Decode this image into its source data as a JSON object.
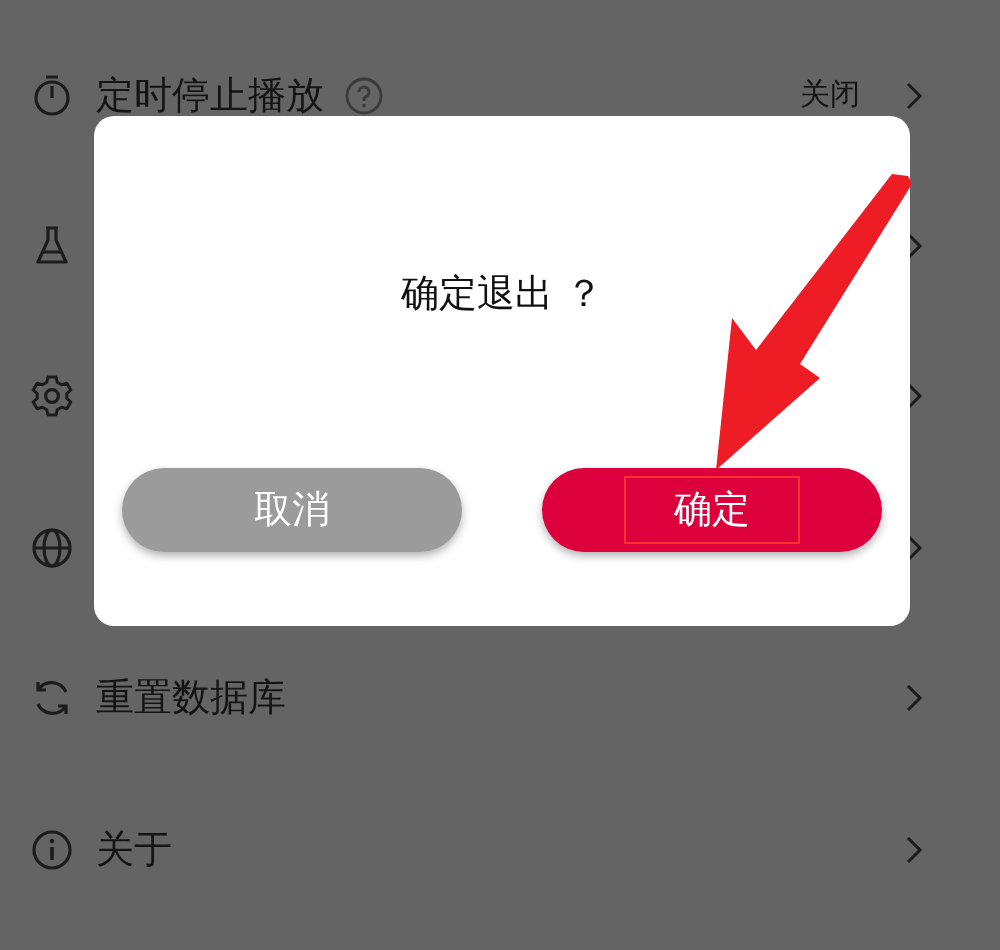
{
  "settings": [
    {
      "kind": "nav",
      "label": "定时停止播放",
      "help": true,
      "value": "关闭"
    },
    {
      "kind": "nav"
    },
    {
      "kind": "nav"
    },
    {
      "kind": "nav"
    },
    {
      "kind": "nav",
      "label": "重置数据库"
    },
    {
      "kind": "nav",
      "label": "关于"
    }
  ],
  "dialog": {
    "message": "确定退出 ？",
    "buttons": [
      {
        "kind": "cancel",
        "label": "取消"
      },
      {
        "kind": "confirm",
        "label": "确定",
        "highlighted": true
      }
    ]
  },
  "annotation": {
    "kind": "arrow"
  }
}
